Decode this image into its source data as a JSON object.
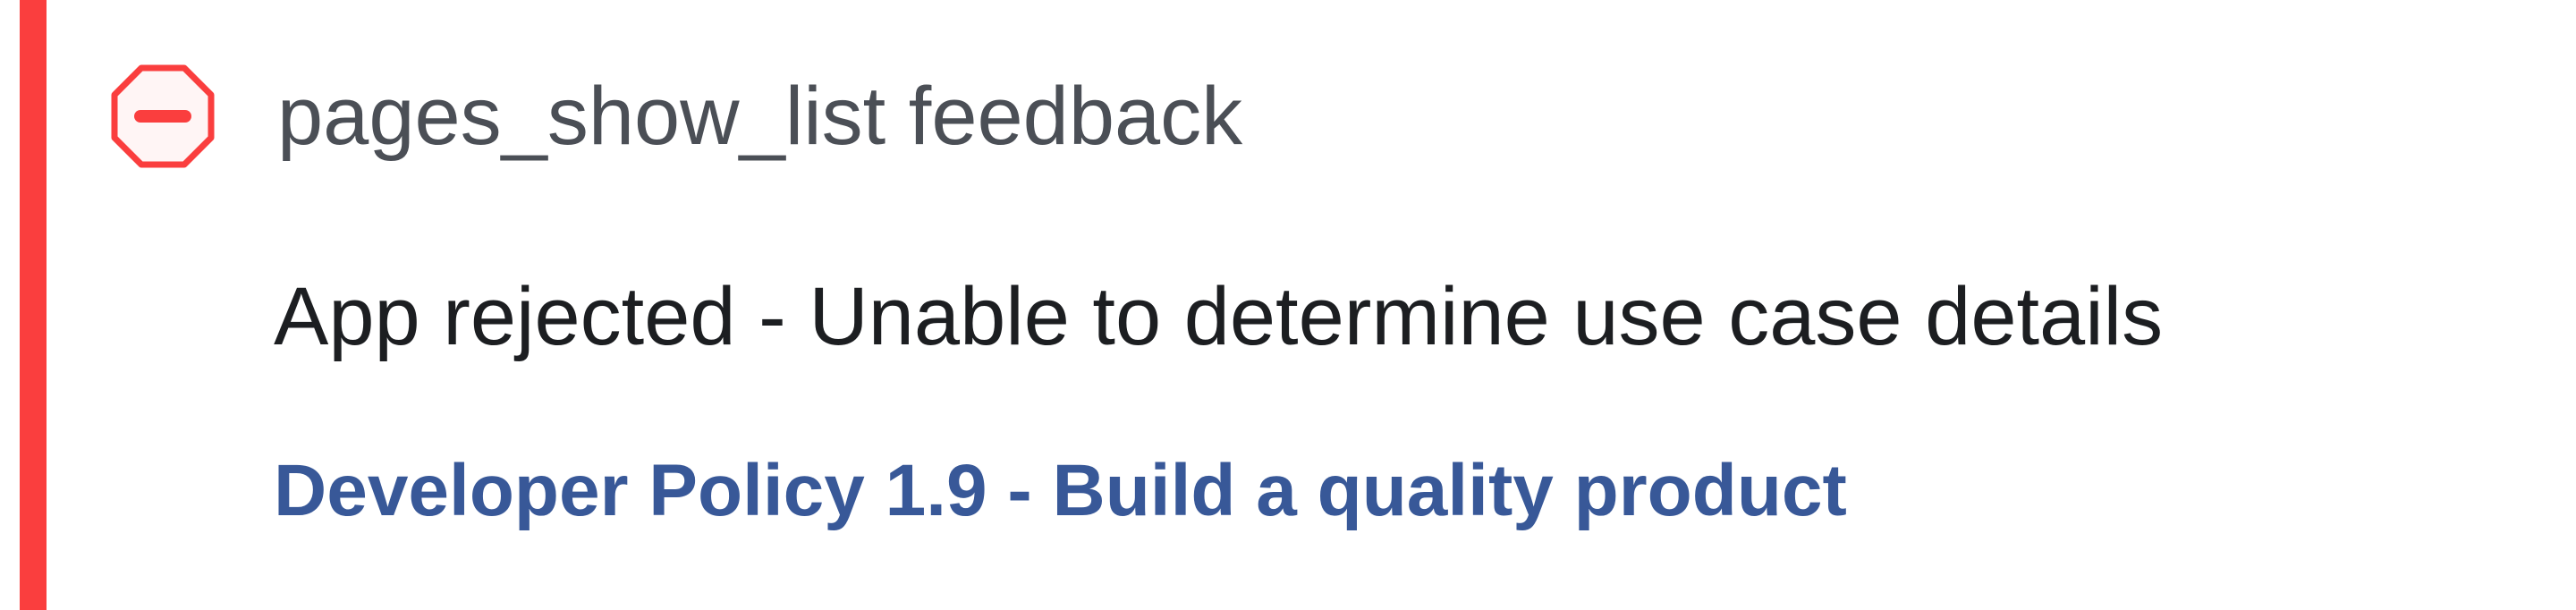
{
  "feedback": {
    "status_icon": "rejected-minus-octagon-icon",
    "title": "pages_show_list feedback",
    "reason": "App rejected - Unable to determine use case details",
    "policy_link": "Developer Policy 1.9 - Build a quality product"
  },
  "colors": {
    "accent": "#fa3e3e",
    "title_text": "#4b4f56",
    "reason_text": "#1c1e21",
    "link_text": "#385898"
  }
}
